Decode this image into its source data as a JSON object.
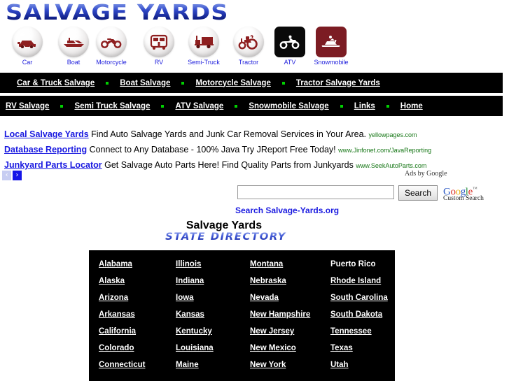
{
  "site": {
    "logo": "Salvage Yards"
  },
  "icons": [
    {
      "label": "Car",
      "icon": "car-icon",
      "style": "round"
    },
    {
      "label": "Boat",
      "icon": "boat-icon",
      "style": "round"
    },
    {
      "label": "Motorcycle",
      "icon": "motorcycle-icon",
      "style": "round"
    },
    {
      "label": "RV",
      "icon": "rv-icon",
      "style": "round"
    },
    {
      "label": "Semi-Truck",
      "icon": "semi-truck-icon",
      "style": "round"
    },
    {
      "label": "Tractor",
      "icon": "tractor-icon",
      "style": "round"
    },
    {
      "label": "ATV",
      "icon": "atv-icon",
      "style": "square-black"
    },
    {
      "label": "Snowmobile",
      "icon": "snowmobile-icon",
      "style": "square-red"
    }
  ],
  "nav_row_1": [
    "Car & Truck Salvage",
    "Boat Salvage",
    "Motorcycle Salvage",
    "Tractor Salvage Yards"
  ],
  "nav_row_2": [
    "RV Salvage",
    "Semi Truck Salvage",
    "ATV Salvage",
    "Snowmobile Salvage",
    "Links",
    "Home"
  ],
  "ads": {
    "label": "Ads by Google",
    "items": [
      {
        "title": "Local Salvage Yards",
        "desc": "Find Auto Salvage Yards and Junk Car Removal Services in Your Area.",
        "url": "yellowpages.com"
      },
      {
        "title": "Database Reporting",
        "desc": "Connect to Any Database - 100% Java Try JReport Free Today!",
        "url": "www.Jinfonet.com/JavaReporting"
      },
      {
        "title": "Junkyard Parts Locator",
        "desc": "Get Salvage Auto Parts Here! Find Quality Parts from Junkyards",
        "url": "www.SeekAutoParts.com"
      }
    ],
    "pager": {
      "prev": "‹",
      "next": "›"
    }
  },
  "search": {
    "value": "",
    "placeholder": "",
    "button_label": "Search",
    "brand_logo": "Google",
    "brand_tm": "™",
    "brand_sub": "Custom Search",
    "site_label": "Search Salvage-Yards.org"
  },
  "title": {
    "main": "Salvage Yards",
    "sub": "State Directory"
  },
  "states": [
    {
      "name": "Alabama",
      "link": true
    },
    {
      "name": "Illinois",
      "link": true
    },
    {
      "name": "Montana",
      "link": true
    },
    {
      "name": "Puerto Rico",
      "link": false
    },
    {
      "name": "Alaska",
      "link": true
    },
    {
      "name": "Indiana",
      "link": true
    },
    {
      "name": "Nebraska",
      "link": true
    },
    {
      "name": "Rhode Island",
      "link": true
    },
    {
      "name": "Arizona",
      "link": true
    },
    {
      "name": "Iowa",
      "link": true
    },
    {
      "name": "Nevada",
      "link": true
    },
    {
      "name": "South Carolina",
      "link": true
    },
    {
      "name": "Arkansas",
      "link": true
    },
    {
      "name": "Kansas",
      "link": true
    },
    {
      "name": "New Hampshire",
      "link": true
    },
    {
      "name": "South Dakota",
      "link": true
    },
    {
      "name": "California",
      "link": true
    },
    {
      "name": "Kentucky",
      "link": true
    },
    {
      "name": "New Jersey",
      "link": true
    },
    {
      "name": "Tennessee",
      "link": true
    },
    {
      "name": "Colorado",
      "link": true
    },
    {
      "name": "Louisiana",
      "link": true
    },
    {
      "name": "New Mexico",
      "link": true
    },
    {
      "name": "Texas",
      "link": true
    },
    {
      "name": "Connecticut",
      "link": true
    },
    {
      "name": "Maine",
      "link": true
    },
    {
      "name": "New York",
      "link": true
    },
    {
      "name": "Utah",
      "link": true
    }
  ]
}
